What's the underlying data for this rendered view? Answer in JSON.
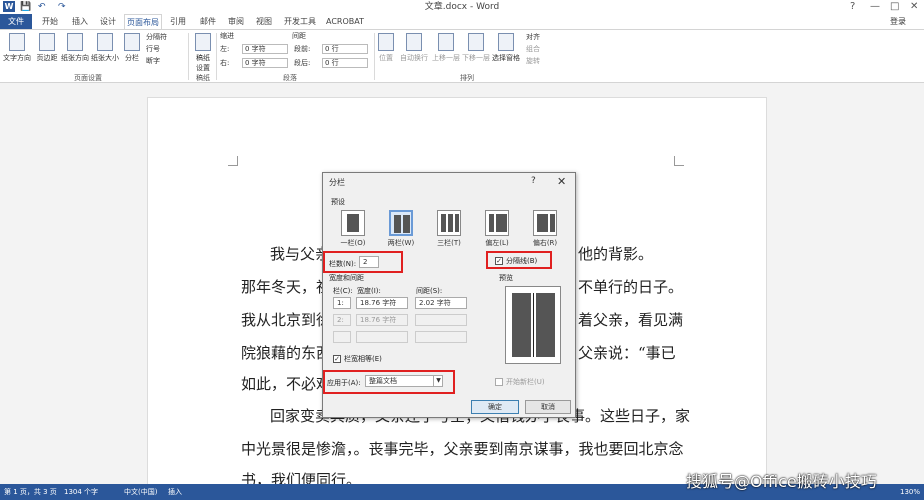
{
  "window": {
    "title": "文章.docx - Word",
    "login": "登录",
    "help": "?",
    "minimize": "—",
    "restore": "□",
    "close": "✕"
  },
  "quick_access": {
    "save": "💾",
    "undo": "↶",
    "redo": "↷"
  },
  "tabs": [
    {
      "label": "文件"
    },
    {
      "label": "开始"
    },
    {
      "label": "插入"
    },
    {
      "label": "设计"
    },
    {
      "label": "页面布局"
    },
    {
      "label": "引用"
    },
    {
      "label": "邮件"
    },
    {
      "label": "审阅"
    },
    {
      "label": "视图"
    },
    {
      "label": "开发工具"
    },
    {
      "label": "ACROBAT"
    }
  ],
  "ribbon": {
    "page_setup": {
      "text_direction": "文字方向",
      "margins": "页边距",
      "orientation": "纸张方向",
      "size": "纸张大小",
      "columns": "分栏",
      "breaks": "分隔符",
      "line_numbers": "行号",
      "hyphenation": "断字",
      "group": "页面设置"
    },
    "manuscript": {
      "label": "稿纸设置",
      "group": "稿纸"
    },
    "paragraph": {
      "indent": "缩进",
      "spacing": "间距",
      "left": "左:",
      "right": "右:",
      "before": "段前:",
      "after": "段后:",
      "left_val": "0 字符",
      "right_val": "0 字符",
      "before_val": "0 行",
      "after_val": "0 行",
      "group": "段落"
    },
    "arrange": {
      "position": "位置",
      "wrap": "自动换行",
      "forward": "上移一层",
      "backward": "下移一层",
      "selection": "选择窗格",
      "align": "对齐",
      "group_btn": "组合",
      "rotate": "旋转",
      "group": "排列"
    }
  },
  "document": {
    "lines": [
      "我与父亲",
      "那年冬天，祖",
      "我从北京到徐",
      "院狼藉的东西",
      "如此，不必难",
      "回家变卖典质，父亲还了亏空；又借钱办了丧事。这些日子，家",
      "中光景很是惨澹，。丧事完毕，父亲要到南京谋事，我也要回北京念",
      "书，我们便同行。"
    ],
    "right_lines": [
      "他的背影。",
      "不单行的日子。",
      "着父亲，看见满",
      "父亲说：“事已"
    ]
  },
  "dialog": {
    "title": "分栏",
    "help": "?",
    "close": "✕",
    "presets_label": "预设",
    "presets": [
      {
        "label": "一栏(O)"
      },
      {
        "label": "两栏(W)"
      },
      {
        "label": "三栏(T)"
      },
      {
        "label": "偏左(L)"
      },
      {
        "label": "偏右(R)"
      }
    ],
    "columns_label": "栏数(N):",
    "columns_value": "2",
    "separator_label": "分隔线(B)",
    "separator_checked": true,
    "width_spacing_label": "宽度和间距",
    "preview_label": "预览",
    "col_header": "栏(C):",
    "width_header": "宽度(I):",
    "spacing_header": "间距(S):",
    "rows": [
      {
        "num": "1:",
        "width": "18.76 字符",
        "spacing": "2.02 字符"
      },
      {
        "num": "2:",
        "width": "18.76 字符",
        "spacing": ""
      },
      {
        "num": "",
        "width": "",
        "spacing": ""
      }
    ],
    "equal_width_label": "栏宽相等(E)",
    "equal_width_checked": true,
    "apply_label": "应用于(A):",
    "apply_value": "整篇文档",
    "new_column_label": "开始新栏(U)",
    "ok": "确定",
    "cancel": "取消"
  },
  "status": {
    "page": "第 1 页，共 3 页",
    "words": "1304 个字",
    "lang": "中文(中国)",
    "mode": "插入",
    "zoom": "130%"
  },
  "watermark": "搜狐号@Office搬砖小技巧",
  "colors": {
    "accent": "#2b579a",
    "highlight": "#e02020"
  }
}
